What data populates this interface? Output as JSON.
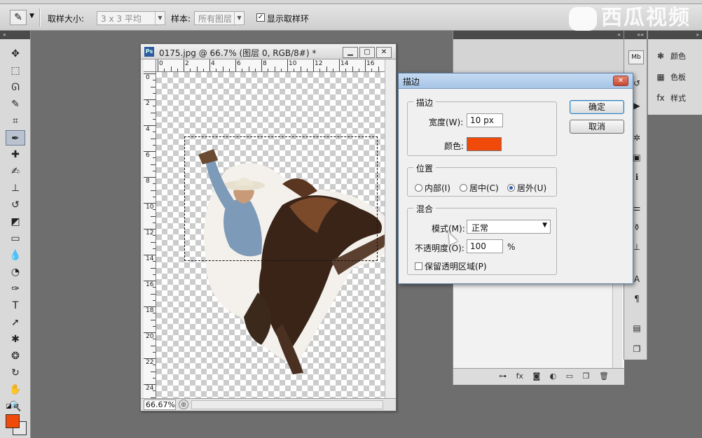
{
  "options_bar": {
    "sample_size_label": "取样大小:",
    "sample_size_value": "3 x 3 平均",
    "sample_label": "样本:",
    "sample_value": "所有图层",
    "show_ring_label": "显示取样环",
    "show_ring_checked": true
  },
  "watermark": {
    "text": "西瓜视频"
  },
  "document": {
    "title": "0175.jpg @ 66.7% (图层 0, RGB/8#) *",
    "app_badge": "Ps",
    "zoom": "66.67%",
    "ruler_top": [
      "0",
      "2",
      "4",
      "6",
      "8",
      "10",
      "12",
      "14",
      "16"
    ],
    "ruler_left": [
      "0",
      "2",
      "4",
      "6",
      "8",
      "10",
      "12",
      "14",
      "16",
      "18",
      "20",
      "22",
      "24"
    ]
  },
  "panels": {
    "color_label": "颜色",
    "swatches_label": "色板",
    "styles_label": "样式"
  },
  "dialog": {
    "title": "描边",
    "stroke_group": "描边",
    "width_label": "宽度(W):",
    "width_value": "10 px",
    "color_label": "颜色:",
    "stroke_color": "#f04a0a",
    "position_group": "位置",
    "pos_inside": "内部(I)",
    "pos_center": "居中(C)",
    "pos_outside": "居外(U)",
    "position_selected": "outside",
    "blend_group": "混合",
    "mode_label": "模式(M):",
    "mode_value": "正常",
    "opacity_label": "不透明度(O):",
    "opacity_value": "100",
    "opacity_unit": "%",
    "preserve_label": "保留透明区域(P)",
    "preserve_checked": false,
    "ok_label": "确定",
    "cancel_label": "取消"
  },
  "colors": {
    "foreground": "#f04a0a",
    "background": "#e6e6e6"
  }
}
